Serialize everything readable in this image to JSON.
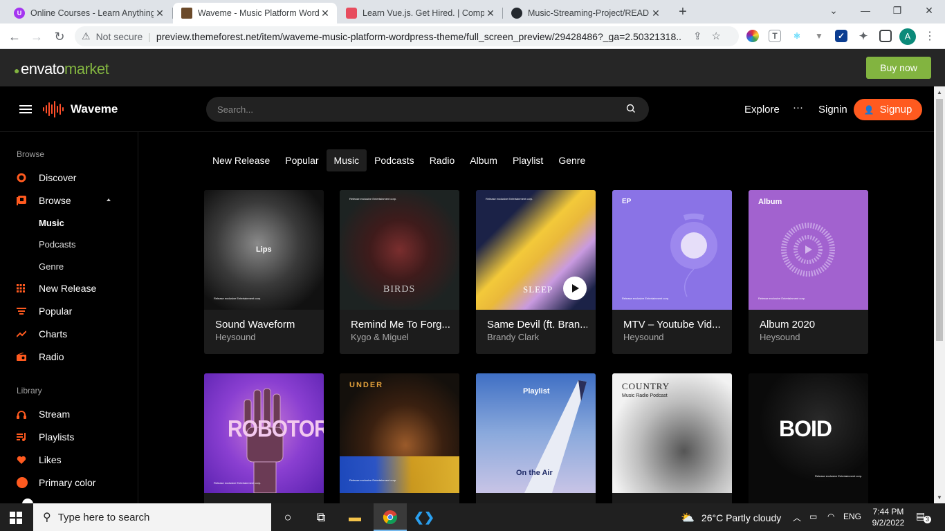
{
  "browser": {
    "tabs": [
      {
        "title": "Online Courses - Learn Anything, On Your Schedule | Udemy",
        "active": false
      },
      {
        "title": "Waveme - Music Platform WordPress Theme",
        "active": true
      },
      {
        "title": "Learn Vue.js. Get Hired. | Complete Vue.js Course",
        "active": false
      },
      {
        "title": "Music-Streaming-Project/README.md",
        "active": false
      }
    ],
    "not_secure": "Not secure",
    "url": "preview.themeforest.net/item/waveme-music-platform-wordpress-theme/full_screen_preview/29428486?_ga=2.50321318....",
    "profile_initial": "A"
  },
  "envato": {
    "logo_envato": "envato",
    "logo_market": "market",
    "buy_now": "Buy now"
  },
  "waveme": {
    "brand": "Waveme",
    "search_placeholder": "Search...",
    "nav": {
      "explore": "Explore",
      "more": "···",
      "signin": "Signin",
      "signup": "Signup"
    },
    "sidebar": {
      "browse_heading": "Browse",
      "items": [
        {
          "label": "Discover",
          "icon": "discover-icon"
        },
        {
          "label": "Browse",
          "icon": "browse-icon"
        }
      ],
      "browse_sub": [
        "Music",
        "Podcasts",
        "Genre"
      ],
      "more_items": [
        {
          "label": "New Release",
          "icon": "grid-icon"
        },
        {
          "label": "Popular",
          "icon": "popular-icon"
        },
        {
          "label": "Charts",
          "icon": "charts-icon"
        },
        {
          "label": "Radio",
          "icon": "radio-icon"
        }
      ],
      "library_heading": "Library",
      "library_items": [
        {
          "label": "Stream",
          "icon": "headphones-icon"
        },
        {
          "label": "Playlists",
          "icon": "playlist-icon"
        },
        {
          "label": "Likes",
          "icon": "heart-icon"
        },
        {
          "label": "Primary color",
          "icon": "color-dot-icon"
        }
      ]
    },
    "tabs": [
      "New Release",
      "Popular",
      "Music",
      "Podcasts",
      "Radio",
      "Album",
      "Playlist",
      "Genre"
    ],
    "active_tab": "Music",
    "cards_row1": [
      {
        "title": "Sound Waveform",
        "artist": "Heysound",
        "art_text": "Lips"
      },
      {
        "title": "Remind Me To Forg...",
        "artist": "Kygo & Miguel",
        "art_text": "BIRDS"
      },
      {
        "title": "Same Devil (ft. Bran...",
        "artist": "Brandy Clark",
        "art_text": "SLEEP"
      },
      {
        "title": "MTV – Youtube Vid...",
        "artist": "Heysound",
        "art_text": "EP"
      },
      {
        "title": "Album 2020",
        "artist": "Heysound",
        "art_text": "Album"
      }
    ],
    "cards_row2_art": [
      "ROBOTOR",
      "UNDER",
      "Playlist",
      "On the Air",
      "COUNTRY",
      "Music Radio Podcast",
      "BOID"
    ],
    "art_caption": "Release exclusive Entertainment corp.",
    "colors": {
      "accent": "#ff5a1f",
      "envato_green": "#82b440"
    }
  },
  "taskbar": {
    "search_placeholder": "Type here to search",
    "weather": "26°C  Partly cloudy",
    "lang": "ENG",
    "time": "7:44 PM",
    "date": "9/2/2022",
    "notifications": "3"
  }
}
